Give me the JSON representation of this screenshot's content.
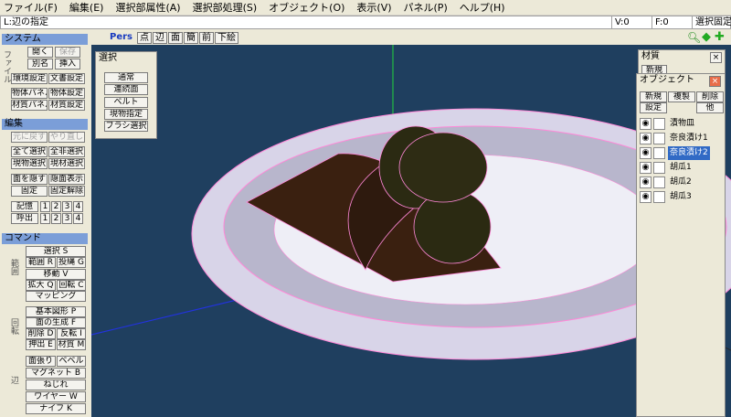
{
  "menu": [
    "ファイル(F)",
    "編集(E)",
    "選択部属性(A)",
    "選択部処理(S)",
    "オブジェクト(O)",
    "表示(V)",
    "パネル(P)",
    "ヘルプ(H)"
  ],
  "status": {
    "mode": "L:辺の指定",
    "v": "V:0",
    "f": "F:0",
    "fix": "選択固定"
  },
  "left": {
    "system": {
      "title": "システム",
      "side": "ファイル",
      "open": "開く",
      "save": "保存",
      "saveas": "別名",
      "insert": "挿入",
      "env": "環境設定",
      "docset": "文書設定",
      "objpanel": "物体パネル",
      "objset": "物体設定",
      "matpanel": "材質パネル",
      "matset": "材質設定"
    },
    "edit": {
      "title": "編集",
      "undo": "元に戻す",
      "redo": "やり直し",
      "selall": "全て選択",
      "deselall": "全非選択",
      "selcur": "現物選択",
      "selmat": "現材選択",
      "hide": "面を隠す",
      "showhid": "隠面表示",
      "fix": "固定",
      "unfix": "固定解除",
      "mem": "記憶",
      "recall": "呼出",
      "n1": "1",
      "n2": "2",
      "n3": "3",
      "n4": "4"
    },
    "command": {
      "title": "コマンド",
      "side1": "範囲",
      "side2": "回転",
      "side3": "辺",
      "select": "選択 S",
      "range": "範囲 R",
      "lasso": "投縄 G",
      "move": "移動 V",
      "scale": "拡大 Q",
      "rotate": "回転 C",
      "magnet_mv": "マッピング",
      "basic": "基本図形 P",
      "face": "面の生成 F",
      "del": "削除 D",
      "flip": "反転 I",
      "extrude": "押出 E",
      "material": "材質 M",
      "stretch": "面張り",
      "bevel": "ベベル",
      "magnet": "マグネット B",
      "twist": "ねじれ",
      "wire": "ワイヤー W",
      "knife": "ナイフ K"
    }
  },
  "viewport": {
    "pers": "Pers",
    "tools": [
      "点",
      "辺",
      "面",
      "簡",
      "前",
      "下絵"
    ]
  },
  "select_panel": {
    "title": "選択",
    "normal": "通常",
    "continuous": "連続面",
    "belt": "ベルト",
    "current": "現物指定",
    "brush": "ブラシ選択"
  },
  "material_panel": {
    "title": "材質",
    "new": "新規",
    "close": "×"
  },
  "object_panel": {
    "title": "オブジェクト",
    "new": "新規",
    "copy": "複製",
    "del": "削除",
    "set": "設定",
    "other": "他",
    "close": "×",
    "objects": [
      {
        "name": "漬物皿",
        "sel": false
      },
      {
        "name": "奈良漬け1",
        "sel": false
      },
      {
        "name": "奈良漬け2",
        "sel": true
      },
      {
        "name": "胡瓜1",
        "sel": false
      },
      {
        "name": "胡瓜2",
        "sel": false
      },
      {
        "name": "胡瓜3",
        "sel": false
      }
    ]
  },
  "colors": {
    "bg": "#1f3f5f",
    "select": "#316ac5",
    "wire": "#ff88d8"
  }
}
